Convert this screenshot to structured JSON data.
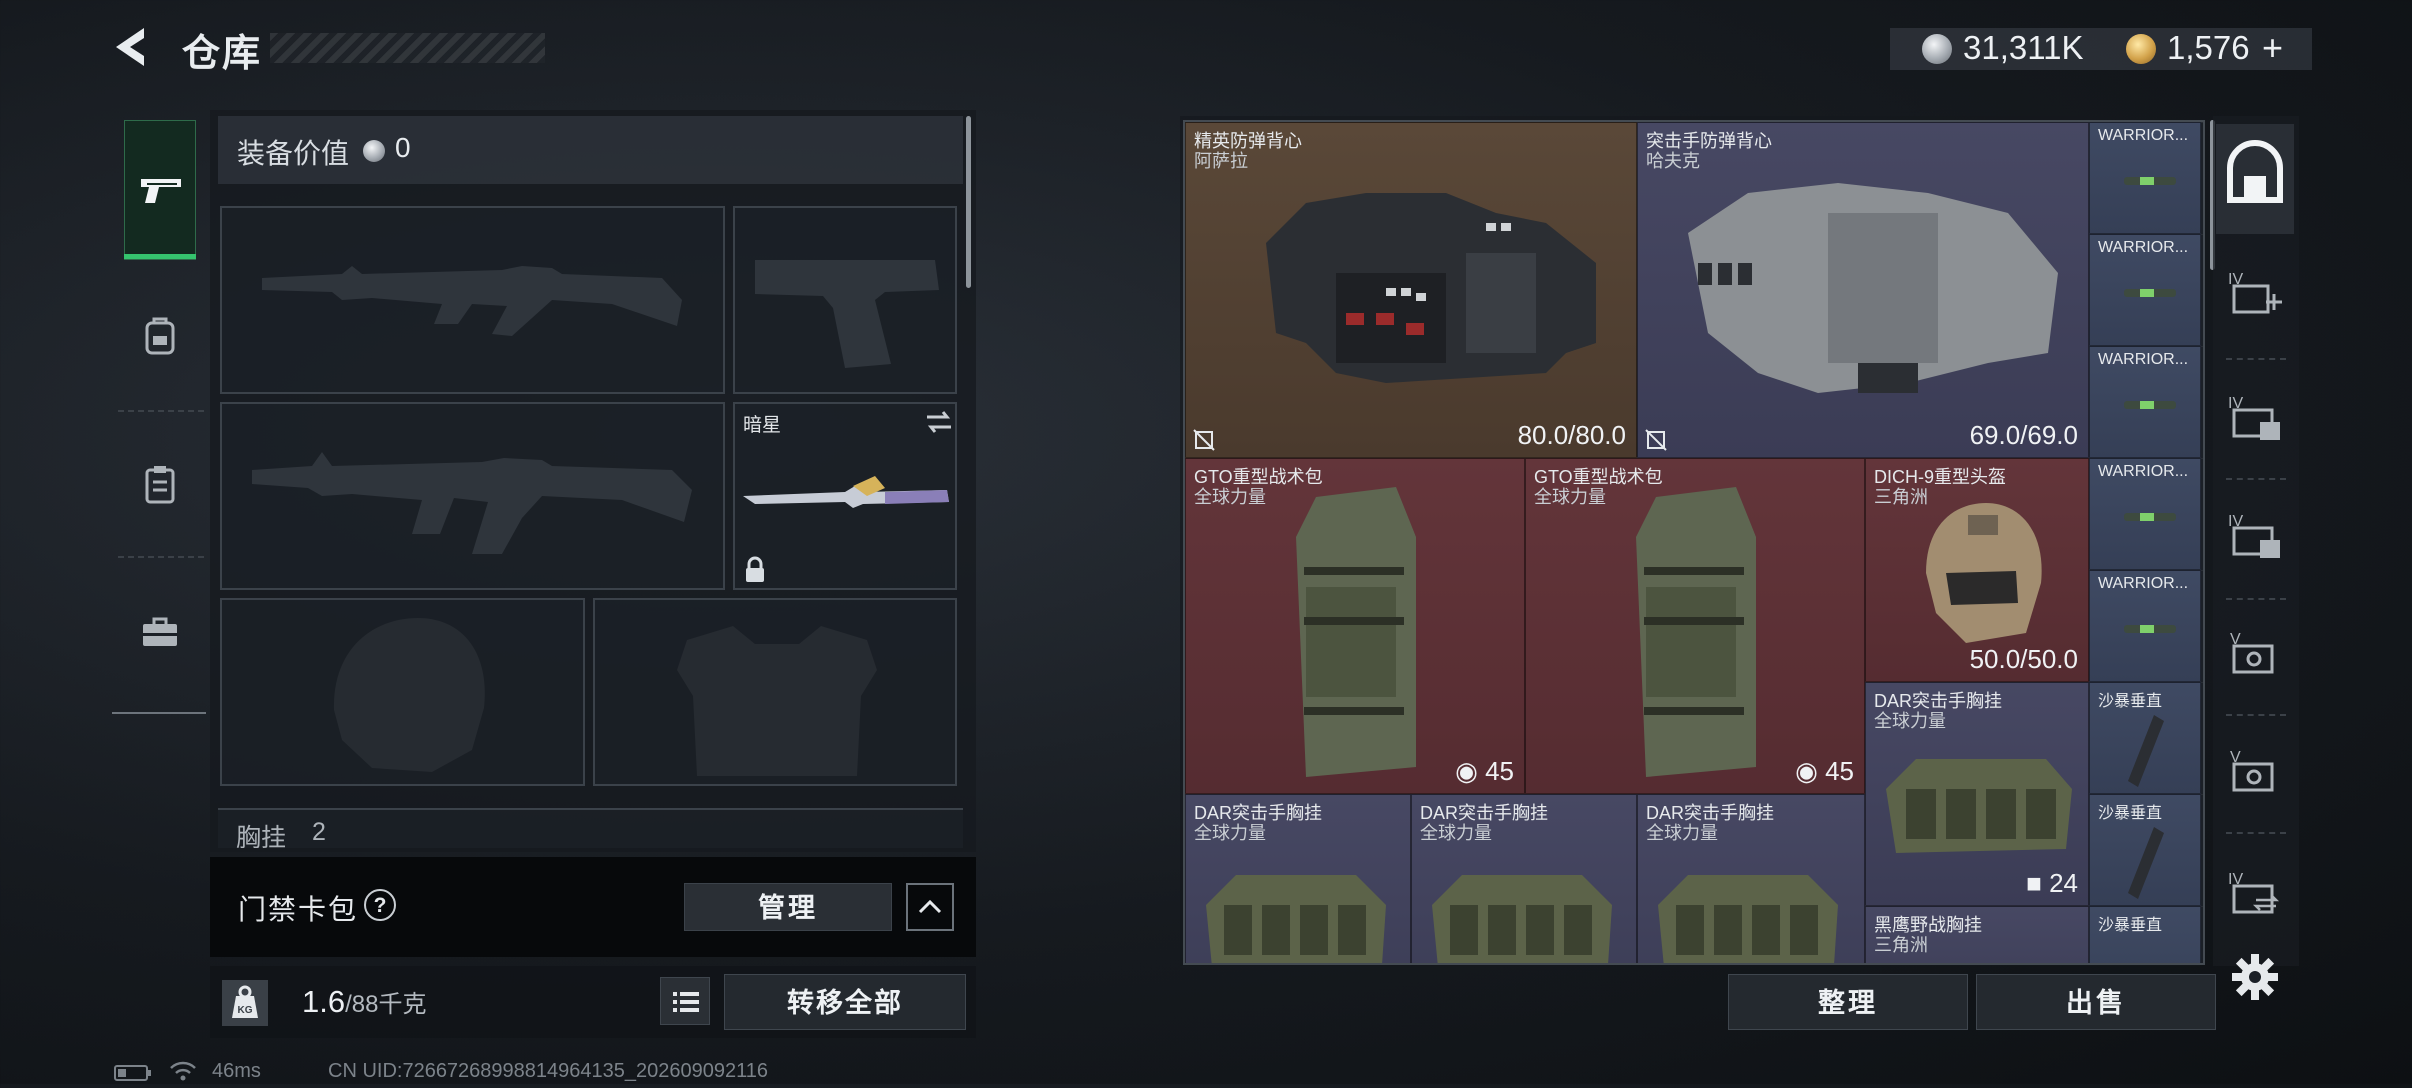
{
  "header": {
    "title": "仓库",
    "currency": [
      {
        "icon": "silver-coin-icon",
        "value": "31,311K"
      },
      {
        "icon": "gold-coin-icon",
        "value": "1,576",
        "add": "+"
      }
    ]
  },
  "left_nav": [
    {
      "icon": "pistol-icon",
      "active": true
    },
    {
      "icon": "backpack-icon"
    },
    {
      "icon": "clipboard-icon"
    },
    {
      "icon": "toolbox-icon"
    }
  ],
  "equipment": {
    "value_label": "装备价值",
    "value": "0",
    "slots": [
      {
        "name": "primary-weapon-slot",
        "icon": "rifle-silhouette-icon"
      },
      {
        "name": "pistol-slot",
        "icon": "pistol-silhouette-icon"
      },
      {
        "name": "secondary-weapon-slot",
        "icon": "rifle-silhouette-icon"
      },
      {
        "name": "melee-slot",
        "label": "暗星",
        "icon": "knife-icon",
        "locked": true
      },
      {
        "name": "helmet-slot",
        "icon": "helmet-silhouette-icon"
      },
      {
        "name": "armor-slot",
        "icon": "vest-silhouette-icon"
      }
    ],
    "chest_label": "胸挂",
    "chest_count": "2"
  },
  "keycard": {
    "label": "门禁卡包",
    "help": "?",
    "manage": "管理"
  },
  "weight": {
    "value": "1.6",
    "max": "/88千克"
  },
  "actions": {
    "transfer_all": "转移全部",
    "organize": "整理",
    "sell": "出售"
  },
  "status_bar": {
    "ping": "46ms",
    "uid": "CN UID:72667268998814964135_202609092116"
  },
  "storage_items": [
    {
      "id": "vest1",
      "name1": "精英防弹背心",
      "name2": "阿萨拉",
      "value": "80.0/80.0",
      "rarity": "brown",
      "icon": "armor-vest-icon"
    },
    {
      "id": "vest2",
      "name1": "突击手防弹背心",
      "name2": "哈夫克",
      "value": "69.0/69.0",
      "rarity": "purple",
      "icon": "armor-vest-icon"
    },
    {
      "id": "w1",
      "name1": "WARRIOR...",
      "rarity": "blue",
      "icon": "injector-icon"
    },
    {
      "id": "w2",
      "name1": "WARRIOR...",
      "rarity": "blue",
      "icon": "injector-icon"
    },
    {
      "id": "w3",
      "name1": "WARRIOR...",
      "rarity": "blue",
      "icon": "injector-icon"
    },
    {
      "id": "w4",
      "name1": "WARRIOR...",
      "rarity": "blue",
      "icon": "injector-icon"
    },
    {
      "id": "w5",
      "name1": "WARRIOR...",
      "rarity": "blue",
      "icon": "injector-icon"
    },
    {
      "id": "bag1",
      "name1": "GTO重型战术包",
      "name2": "全球力量",
      "value": "45",
      "rarity": "red",
      "icon": "backpack-icon"
    },
    {
      "id": "bag2",
      "name1": "GTO重型战术包",
      "name2": "全球力量",
      "value": "45",
      "rarity": "red",
      "icon": "backpack-icon"
    },
    {
      "id": "helmet",
      "name1": "DICH-9重型头盔",
      "name2": "三角洲",
      "value": "50.0/50.0",
      "rarity": "red",
      "icon": "helmet-icon"
    },
    {
      "id": "chest_big",
      "name1": "DAR突击手胸挂",
      "name2": "全球力量",
      "value": "24",
      "rarity": "purple",
      "icon": "chest-rig-icon"
    },
    {
      "id": "sand1",
      "name1": "沙暴垂直",
      "rarity": "blue",
      "icon": "grip-icon"
    },
    {
      "id": "sand2",
      "name1": "沙暴垂直",
      "rarity": "blue",
      "icon": "grip-icon"
    },
    {
      "id": "sand3",
      "name1": "沙暴垂直",
      "rarity": "blue",
      "icon": "grip-icon"
    },
    {
      "id": "chest1",
      "name1": "DAR突击手胸挂",
      "name2": "全球力量",
      "rarity": "purple",
      "icon": "chest-rig-icon"
    },
    {
      "id": "chest2",
      "name1": "DAR突击手胸挂",
      "name2": "全球力量",
      "rarity": "purple",
      "icon": "chest-rig-icon"
    },
    {
      "id": "chest3",
      "name1": "DAR突击手胸挂",
      "name2": "全球力量",
      "rarity": "purple",
      "icon": "chest-rig-icon"
    },
    {
      "id": "hawk",
      "name1": "黑鹰野战胸挂",
      "name2": "三角洲",
      "rarity": "purple",
      "icon": "chest-rig-icon"
    }
  ],
  "right_tabs": [
    {
      "icon": "storage-home-icon",
      "active": true
    },
    {
      "icon": "expand-storage-icon",
      "label": "IV"
    },
    {
      "icon": "storage-iv-icon",
      "label": "IV"
    },
    {
      "icon": "storage-iv-icon",
      "label": "IV"
    },
    {
      "icon": "storage-v-icon",
      "label": "V"
    },
    {
      "icon": "storage-v-icon",
      "label": "V"
    },
    {
      "icon": "storage-iv-icon",
      "label": "IV"
    }
  ],
  "colors": {
    "accent_green": "#35c46e",
    "rarity_brown": "#5a4838",
    "rarity_purple": "#474863",
    "rarity_red": "#63353a",
    "rarity_blue": "#3f4a63"
  }
}
